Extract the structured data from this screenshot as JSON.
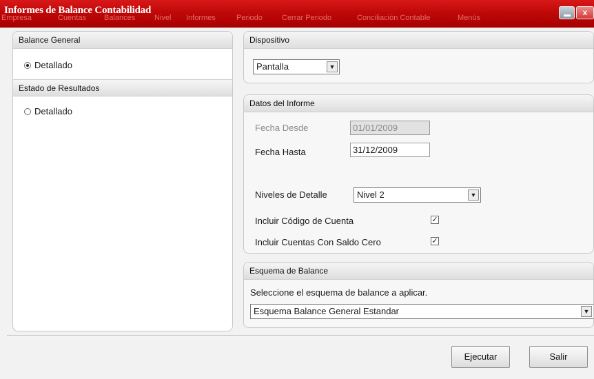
{
  "window": {
    "title": "Informes de Balance Contabilidad",
    "close_glyph": "x",
    "ghost_menu": [
      "Empresa",
      "Cuentas",
      "Balances",
      "Nivel",
      "Informes",
      "Periodo",
      "Cerrar Periodo",
      "Conciliación Contable",
      "Menús"
    ]
  },
  "left_panel": {
    "section1_title": "Balance General",
    "section1_option": "Detallado",
    "section1_selected": true,
    "section2_title": "Estado de Resultados",
    "section2_option": "Detallado",
    "section2_selected": false
  },
  "dispositivo": {
    "title": "Dispositivo",
    "selected": "Pantalla"
  },
  "datos": {
    "title": "Datos del Informe",
    "fecha_desde_label": "Fecha Desde",
    "fecha_desde_value": "01/01/2009",
    "fecha_hasta_label": "Fecha Hasta",
    "fecha_hasta_value": "31/12/2009",
    "niveles_label": "Niveles de Detalle",
    "niveles_value": "Nivel 2",
    "incluir_codigo_label": "Incluir Código de Cuenta",
    "incluir_codigo_checked": true,
    "incluir_saldo_label": "Incluir Cuentas Con Saldo Cero",
    "incluir_saldo_checked": true
  },
  "esquema": {
    "title": "Esquema de Balance",
    "instruction": "Seleccione el esquema de balance a aplicar.",
    "selected": "Esquema Balance General Estandar"
  },
  "buttons": {
    "ejecutar": "Ejecutar",
    "salir": "Salir"
  },
  "icons": {
    "dropdown": "chevron-down-icon",
    "checkmark": "checkmark-icon",
    "minimize": "minimize-icon",
    "close": "close-icon"
  },
  "colors": {
    "titlebar": "#c00808",
    "title_text": "#ffffff",
    "panel_header": "#e6e6e6"
  }
}
